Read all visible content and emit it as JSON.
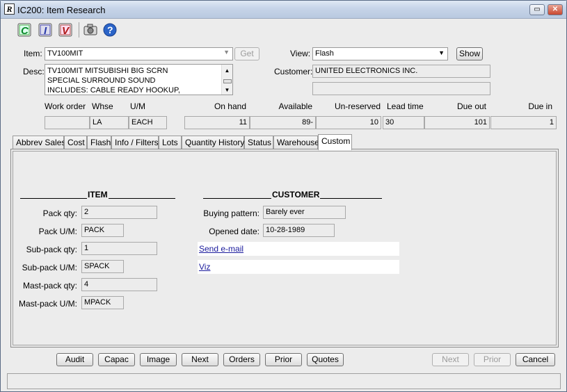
{
  "window": {
    "title": "IC200: Item Research"
  },
  "toolbar": {
    "icons": [
      "c-icon",
      "i-icon",
      "v-icon",
      "camera-icon",
      "help-icon"
    ]
  },
  "header": {
    "item_label": "Item:",
    "item_value": "TV100MIT",
    "get_label": "Get",
    "view_label": "View:",
    "view_value": "Flash",
    "show_label": "Show",
    "desc_label": "Desc:",
    "desc_lines": [
      "TV100MIT MITSUBISHI BIG SCRN",
      "SPECIAL SURROUND SOUND",
      "INCLUDES: CABLE READY HOOKUP,"
    ],
    "customer_label": "Customer:",
    "customer_value": "UNITED ELECTRONICS INC.",
    "customer_value2": ""
  },
  "grid": {
    "headers": {
      "work_order": "Work order",
      "whse": "Whse",
      "um": "U/M",
      "on_hand": "On hand",
      "available": "Available",
      "unreserved": "Un-reserved",
      "lead_time": "Lead time",
      "due_out": "Due out",
      "due_in": "Due in"
    },
    "values": {
      "work_order": "",
      "whse": "LA",
      "um": "EACH",
      "on_hand": "11",
      "available": "89-",
      "unreserved": "10",
      "lead_time": "30",
      "due_out": "101",
      "due_in": "1"
    }
  },
  "tabs": [
    "Abbrev Sales",
    "Cost",
    "Flash",
    "Info / Filters",
    "Lots",
    "Quantity History",
    "Status",
    "Warehouse",
    "Custom"
  ],
  "active_tab": "Custom",
  "item_section": {
    "heading": "ITEM",
    "fields": [
      {
        "label": "Pack qty:",
        "value": "2"
      },
      {
        "label": "Pack U/M:",
        "value": "PACK"
      },
      {
        "label": "Sub-pack qty:",
        "value": "1"
      },
      {
        "label": "Sub-pack U/M:",
        "value": "SPACK"
      },
      {
        "label": "Mast-pack qty:",
        "value": "4"
      },
      {
        "label": "Mast-pack U/M:",
        "value": "MPACK"
      }
    ]
  },
  "customer_section": {
    "heading": "CUSTOMER",
    "fields": [
      {
        "label": "Buying pattern:",
        "value": "Barely ever"
      },
      {
        "label": "Opened date:",
        "value": "10-28-1989"
      }
    ],
    "links": [
      "Send e-mail",
      "Viz"
    ]
  },
  "buttons": {
    "audit": "Audit",
    "capac": "Capac",
    "image": "Image",
    "next": "Next",
    "orders": "Orders",
    "prior": "Prior",
    "quotes": "Quotes",
    "next2": "Next",
    "prior2": "Prior",
    "cancel": "Cancel"
  },
  "status": ""
}
